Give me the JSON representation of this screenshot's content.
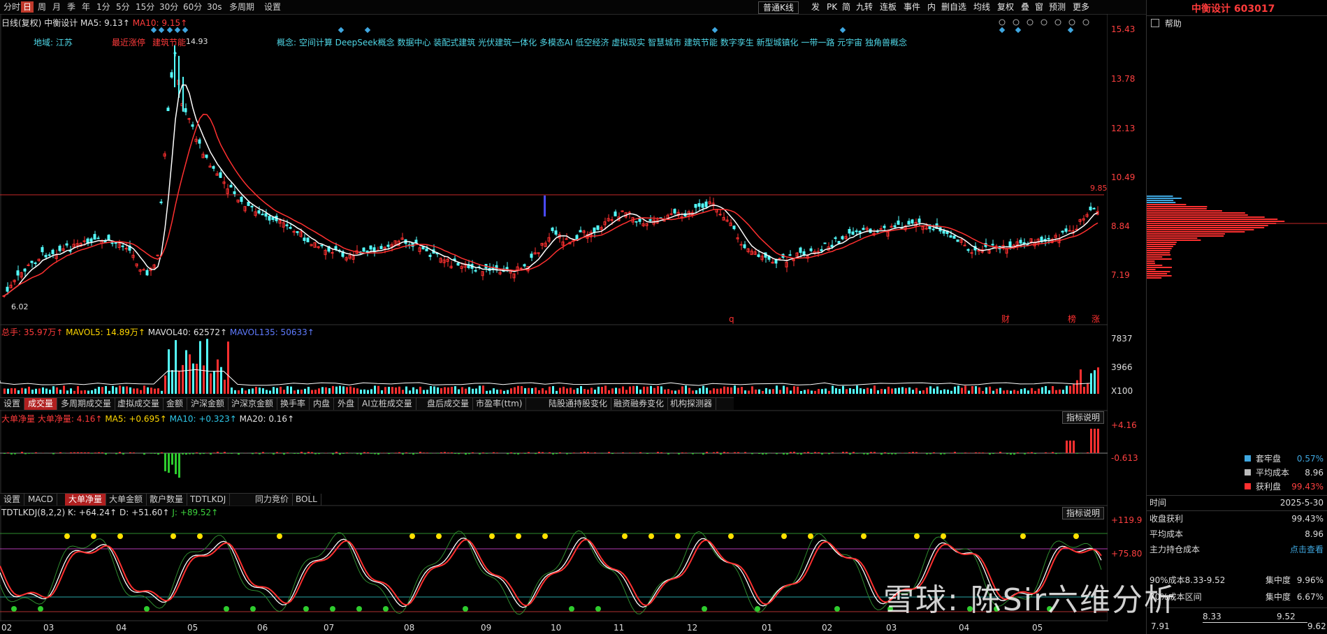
{
  "toolbar": {
    "periods": [
      "分时",
      "日",
      "周",
      "月",
      "季",
      "年",
      "1分",
      "5分",
      "15分",
      "30分",
      "60分",
      "30s",
      "多周期",
      "设置"
    ],
    "selected": "日",
    "right": [
      "普通K线",
      "发",
      "PK",
      "简",
      "九转",
      "连板",
      "事件",
      "内",
      "删自选",
      "均线",
      "复权",
      "叠",
      "窗",
      "预测",
      "更多"
    ]
  },
  "title": "中衡设计 603017",
  "kline_info": {
    "prefix": "日线(复权)",
    "stock": "中衡设计",
    "ma5": "MA5: 9.13↑",
    "ma10": "MA10: 9.15↑"
  },
  "region_tag": "地域: 江苏",
  "recent_tag": "最近涨停",
  "concept_first": "建筑节能",
  "high_label": "14.93",
  "low_label": "6.02",
  "current_price_label": "9.85",
  "concepts": "概念: 空间计算 DeepSeek概念 数据中心 装配式建筑 光伏建筑一体化 多模态AI 低空经济 虚拟现实 智慧城市 建筑节能 数字孪生 新型城镇化 一带一路 元宇宙 独角兽概念",
  "price_axis": [
    "15.43",
    "13.78",
    "12.13",
    "10.49",
    "8.84",
    "7.19"
  ],
  "event_markers": [
    "q",
    "财",
    "榜",
    "涨"
  ],
  "volume_info": {
    "total": "总手: 35.97万↑",
    "mavol5": "MAVOL5: 14.89万↑",
    "mavol40": "MAVOL40: 62572↑",
    "mavol135": "MAVOL135: 50633↑"
  },
  "volume_axis": [
    "7837",
    "3966",
    "X100"
  ],
  "tabs1": [
    "设置",
    "成交量",
    "多周期成交量",
    "虚拟成交量",
    "金额",
    "沪深金额",
    "沪深京金额",
    "换手率",
    "内盘",
    "外盘",
    "AI立桩成交量",
    "盘后成交量",
    "市盈率(ttm)",
    "陆股通持股变化",
    "融资融券变化",
    "机构探测器"
  ],
  "tabs1_selected": "成交量",
  "ddx_info": {
    "name": "大单净量",
    "val": "大单净量: 4.16↑",
    "ma5": "MA5: +0.695↑",
    "ma10": "MA10: +0.323↑",
    "ma20": "MA20: 0.16↑"
  },
  "ddx_axis": [
    "+4.16",
    "-0.613"
  ],
  "explain_label": "指标说明",
  "tabs2": [
    "设置",
    "MACD",
    "大单净量",
    "大单金额",
    "散户数量",
    "TDTLKDJ",
    "同力竞价",
    "BOLL"
  ],
  "tabs2_selected": "大单净量",
  "kdj_info": {
    "name": "TDTLKDJ(8,2,2)",
    "k": "K: +64.24↑",
    "d": "D: +51.60↑",
    "j": "J: +89.52↑"
  },
  "kdj_axis": [
    "+119.9",
    "+75.80"
  ],
  "months": [
    "02",
    "03",
    "04",
    "05",
    "06",
    "07",
    "08",
    "09",
    "10",
    "11",
    "12",
    "01",
    "02",
    "03",
    "04",
    "05"
  ],
  "right_panel": {
    "help": "帮助",
    "legend": [
      {
        "label": "套牢盘",
        "value": "0.57%",
        "color": "#3fa7e0"
      },
      {
        "label": "平均成本",
        "value": "8.96",
        "color": "#bbbbbb"
      },
      {
        "label": "获利盘",
        "value": "99.43%",
        "color": "#ff3030"
      }
    ],
    "date_label": "时间",
    "date": "2025-5-30",
    "rows": [
      {
        "label": "收盘获利",
        "value": "99.43%"
      },
      {
        "label": "平均成本",
        "value": "8.96"
      },
      {
        "label": "主力持仓成本",
        "value": "点击查看"
      }
    ],
    "row_90": "90%成本8.33-9.52",
    "row_90_conc": "9.96%",
    "row_70": "70%成本区间",
    "row_70_conc": "6.67%",
    "conc_label": "集中度",
    "bottom_axis": [
      "7.91",
      "8.33",
      "9.52",
      "9.62"
    ]
  },
  "watermark": "雪球: 陈Sir六维分析",
  "colors": {
    "up": "#ff3030",
    "down": "#54ffff",
    "ma5": "#ffffff",
    "ma10": "#ff3030",
    "bg": "#000000"
  }
}
